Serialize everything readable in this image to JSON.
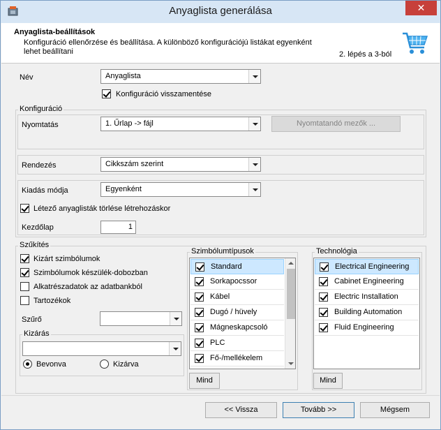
{
  "window": {
    "title": "Anyaglista generálása",
    "close_glyph": "✕"
  },
  "header": {
    "title": "Anyaglista-beállítások",
    "description": "Konfiguráció ellenőrzése és beállítása. A különböző konfigurációjú listákat egyenként lehet beállítani",
    "step": "2. lépés a 3-ból",
    "icon": "shopping-cart-icon"
  },
  "name_row": {
    "label": "Név",
    "value": "Anyaglista",
    "restore_label": "Konfiguráció visszamentése",
    "restore_checked": true
  },
  "config": {
    "title": "Konfiguráció",
    "print_label": "Nyomtatás",
    "print_value": "1. Űrlap -> fájl",
    "print_fields_button": "Nyomtatandó mezők ...",
    "sort_label": "Rendezés",
    "sort_value": "Cikkszám szerint",
    "output_label": "Kiadás módja",
    "output_value": "Egyenként",
    "delete_existing_label": "Létező anyaglisták törlése létrehozáskor",
    "delete_existing_checked": true,
    "start_page_label": "Kezdőlap",
    "start_page_value": "1"
  },
  "filter": {
    "title": "Szűkítés",
    "options": [
      {
        "label": "Kizárt szimbólumok",
        "checked": true
      },
      {
        "label": "Szimbólumok készülék-dobozban",
        "checked": true
      },
      {
        "label": "Alkatrészadatok az adatbankból",
        "checked": false
      },
      {
        "label": "Tartozékok",
        "checked": false
      }
    ],
    "filter_label": "Szűrő",
    "filter_value": "",
    "exclusion": {
      "title": "Kizárás",
      "value": "",
      "radio_included": "Bevonva",
      "radio_excluded": "Kizárva",
      "selected": "Bevonva"
    }
  },
  "symbol_types": {
    "title": "Szimbólumtípusok",
    "items": [
      {
        "label": "Standard",
        "checked": true,
        "selected": true
      },
      {
        "label": "Sorkapocssor",
        "checked": true,
        "selected": false
      },
      {
        "label": "Kábel",
        "checked": true,
        "selected": false
      },
      {
        "label": "Dugó / hüvely",
        "checked": true,
        "selected": false
      },
      {
        "label": "Mágneskapcsoló",
        "checked": true,
        "selected": false
      },
      {
        "label": "PLC",
        "checked": true,
        "selected": false
      },
      {
        "label": "Fő-/mellékelem",
        "checked": true,
        "selected": false
      }
    ],
    "all_button": "Mind"
  },
  "technology": {
    "title": "Technológia",
    "items": [
      {
        "label": "Electrical Engineering",
        "checked": true,
        "selected": true
      },
      {
        "label": "Cabinet Engineering",
        "checked": true,
        "selected": false
      },
      {
        "label": "Electric Installation",
        "checked": true,
        "selected": false
      },
      {
        "label": "Building Automation",
        "checked": true,
        "selected": false
      },
      {
        "label": "Fluid Engineering",
        "checked": true,
        "selected": false
      }
    ],
    "all_button": "Mind"
  },
  "footer": {
    "back_button": "<< Vissza",
    "next_button": "Tovább >>",
    "cancel_button": "Mégsem"
  },
  "colors": {
    "selection": "#cde8ff",
    "titlebar": "#d7e6f5",
    "close": "#c7403a"
  }
}
